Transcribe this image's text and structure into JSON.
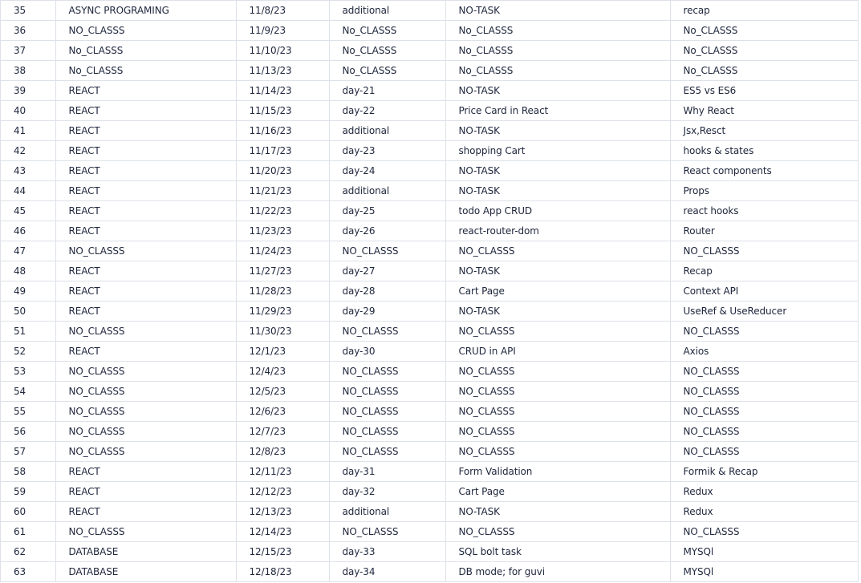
{
  "table": {
    "rows": [
      [
        "35",
        "ASYNC PROGRAMING",
        "11/8/23",
        "additional",
        "NO-TASK",
        "recap"
      ],
      [
        "36",
        "NO_CLASSS",
        "11/9/23",
        "No_CLASSS",
        "No_CLASSS",
        "No_CLASSS"
      ],
      [
        "37",
        "No_CLASSS",
        "11/10/23",
        "No_CLASSS",
        "No_CLASSS",
        "No_CLASSS"
      ],
      [
        "38",
        "No_CLASSS",
        "11/13/23",
        "No_CLASSS",
        "No_CLASSS",
        "No_CLASSS"
      ],
      [
        "39",
        "REACT",
        "11/14/23",
        "day-21",
        "NO-TASK",
        "ES5 vs ES6"
      ],
      [
        "40",
        "REACT",
        "11/15/23",
        "day-22",
        "Price Card in React",
        "Why React"
      ],
      [
        "41",
        "REACT",
        "11/16/23",
        "additional",
        "NO-TASK",
        "Jsx,Resct"
      ],
      [
        "42",
        "REACT",
        "11/17/23",
        "day-23",
        "shopping Cart",
        "hooks & states"
      ],
      [
        "43",
        "REACT",
        "11/20/23",
        "day-24",
        "NO-TASK",
        "React components"
      ],
      [
        "44",
        "REACT",
        "11/21/23",
        "additional",
        "NO-TASK",
        "Props"
      ],
      [
        "45",
        "REACT",
        "11/22/23",
        "day-25",
        "todo App CRUD",
        "react hooks"
      ],
      [
        "46",
        "REACT",
        "11/23/23",
        "day-26",
        "react-router-dom",
        "Router"
      ],
      [
        "47",
        "NO_CLASSS",
        "11/24/23",
        "NO_CLASSS",
        "NO_CLASSS",
        "NO_CLASSS"
      ],
      [
        "48",
        "REACT",
        "11/27/23",
        "day-27",
        "NO-TASK",
        "Recap"
      ],
      [
        "49",
        "REACT",
        "11/28/23",
        "day-28",
        "Cart Page",
        "Context API"
      ],
      [
        "50",
        "REACT",
        "11/29/23",
        "day-29",
        "NO-TASK",
        "UseRef & UseReducer"
      ],
      [
        "51",
        "NO_CLASSS",
        "11/30/23",
        "NO_CLASSS",
        "NO_CLASSS",
        "NO_CLASSS"
      ],
      [
        "52",
        "REACT",
        "12/1/23",
        "day-30",
        "CRUD in API",
        "Axios"
      ],
      [
        "53",
        "NO_CLASSS",
        "12/4/23",
        "NO_CLASSS",
        "NO_CLASSS",
        "NO_CLASSS"
      ],
      [
        "54",
        "NO_CLASSS",
        "12/5/23",
        "NO_CLASSS",
        "NO_CLASSS",
        "NO_CLASSS"
      ],
      [
        "55",
        "NO_CLASSS",
        "12/6/23",
        "NO_CLASSS",
        "NO_CLASSS",
        "NO_CLASSS"
      ],
      [
        "56",
        "NO_CLASSS",
        "12/7/23",
        "NO_CLASSS",
        "NO_CLASSS",
        "NO_CLASSS"
      ],
      [
        "57",
        "NO_CLASSS",
        "12/8/23",
        "NO_CLASSS",
        "NO_CLASSS",
        "NO_CLASSS"
      ],
      [
        "58",
        "REACT",
        "12/11/23",
        "day-31",
        "Form Validation",
        "Formik & Recap"
      ],
      [
        "59",
        "REACT",
        "12/12/23",
        "day-32",
        "Cart Page",
        "Redux"
      ],
      [
        "60",
        "REACT",
        "12/13/23",
        "additional",
        "NO-TASK",
        "Redux"
      ],
      [
        "61",
        "NO_CLASSS",
        "12/14/23",
        "NO_CLASSS",
        "NO_CLASSS",
        "NO_CLASSS"
      ],
      [
        "62",
        "DATABASE",
        "12/15/23",
        "day-33",
        "SQL bolt task",
        "MYSQl"
      ],
      [
        "63",
        "DATABASE",
        "12/18/23",
        "day-34",
        "DB mode; for guvi",
        "MYSQl"
      ]
    ]
  },
  "colors": {
    "text": "#20283e",
    "grid": "#dde1e8",
    "background": "#ffffff"
  }
}
